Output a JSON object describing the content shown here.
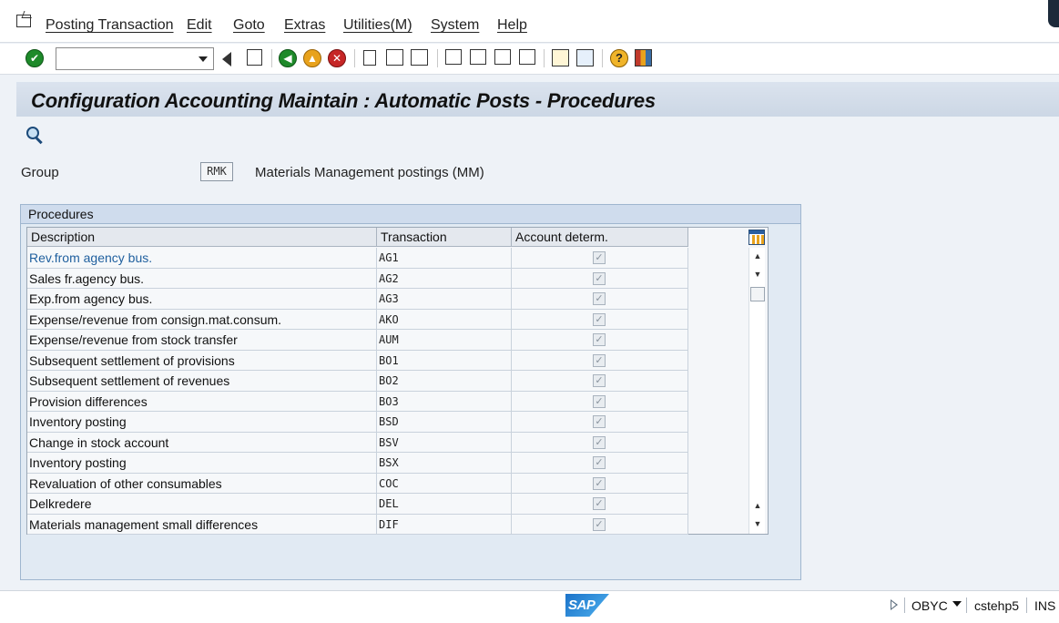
{
  "menu": {
    "items": [
      "Posting Transaction",
      "Edit",
      "Goto",
      "Extras",
      "Utilities(M)",
      "System",
      "Help"
    ]
  },
  "toolbar": {
    "command_field_value": "",
    "buttons": [
      "enter-icon",
      "back-triangle-icon",
      "save-icon",
      "back-icon",
      "exit-icon",
      "cancel-icon",
      "print-icon",
      "find-icon",
      "find-next-icon",
      "first-page-icon",
      "previous-page-icon",
      "next-page-icon",
      "last-page-icon",
      "create-session-icon",
      "shortcut-icon",
      "help-icon",
      "layout-icon"
    ]
  },
  "title": "Configuration Accounting Maintain : Automatic Posts - Procedures",
  "group": {
    "label": "Group",
    "value": "RMK",
    "description": "Materials Management postings (MM)"
  },
  "procedures": {
    "frame_title": "Procedures",
    "columns": [
      "Description",
      "Transaction",
      "Account determ."
    ],
    "rows": [
      {
        "description": "Rev.from agency bus.",
        "transaction": "AG1",
        "account_determ": true
      },
      {
        "description": "Sales fr.agency bus.",
        "transaction": "AG2",
        "account_determ": true
      },
      {
        "description": "Exp.from agency bus.",
        "transaction": "AG3",
        "account_determ": true
      },
      {
        "description": "Expense/revenue from consign.mat.consum.",
        "transaction": "AKO",
        "account_determ": true
      },
      {
        "description": "Expense/revenue from stock transfer",
        "transaction": "AUM",
        "account_determ": true
      },
      {
        "description": "Subsequent settlement of provisions",
        "transaction": "BO1",
        "account_determ": true
      },
      {
        "description": "Subsequent settlement of revenues",
        "transaction": "BO2",
        "account_determ": true
      },
      {
        "description": "Provision differences",
        "transaction": "BO3",
        "account_determ": true
      },
      {
        "description": "Inventory posting",
        "transaction": "BSD",
        "account_determ": true
      },
      {
        "description": "Change in stock account",
        "transaction": "BSV",
        "account_determ": true
      },
      {
        "description": "Inventory posting",
        "transaction": "BSX",
        "account_determ": true
      },
      {
        "description": "Revaluation of other consumables",
        "transaction": "COC",
        "account_determ": true
      },
      {
        "description": "Delkredere",
        "transaction": "DEL",
        "account_determ": true
      },
      {
        "description": "Materials management small differences",
        "transaction": "DIF",
        "account_determ": true
      }
    ],
    "check_glyph": "✓"
  },
  "status": {
    "sap_logo": "SAP",
    "transaction": "OBYC",
    "server": "cstehp5",
    "mode": "INS"
  }
}
